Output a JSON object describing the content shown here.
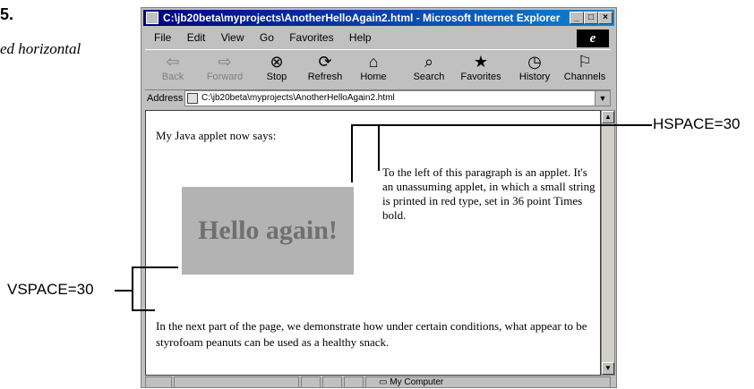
{
  "fragment": {
    "number": "5.",
    "caption": "ed horizontal"
  },
  "window": {
    "title": "C:\\jb20beta\\myprojects\\AnotherHelloAgain2.html - Microsoft Internet Explorer",
    "controls": [
      "minimize",
      "maximize",
      "close"
    ]
  },
  "menu": [
    {
      "label": "File",
      "accel": "F"
    },
    {
      "label": "Edit",
      "accel": "E"
    },
    {
      "label": "View",
      "accel": "V"
    },
    {
      "label": "Go",
      "accel": "G"
    },
    {
      "label": "Favorites",
      "accel": "a"
    },
    {
      "label": "Help",
      "accel": "H"
    }
  ],
  "toolbar": {
    "back": "Back",
    "forward": "Forward",
    "stop": "Stop",
    "refresh": "Refresh",
    "home": "Home",
    "search": "Search",
    "favorites": "Favorites",
    "history": "History",
    "channels": "Channels"
  },
  "address": {
    "label": "Address",
    "value": "C:\\jb20beta\\myprojects\\AnotherHelloAgain2.html"
  },
  "content": {
    "intro": "My Java applet now says:",
    "applet_text": "Hello again!",
    "side_paragraph": "To the left of this paragraph is an applet. It's an unassuming applet, in which a small string is printed in red type, set in 36 point Times bold.",
    "next_paragraph": "In the next part of the page, we demonstrate how under certain conditions, what appear to be styrofoam peanuts can be used as a healthy snack."
  },
  "status": {
    "zone": "My Computer"
  },
  "annotations": {
    "hspace": "HSPACE=30",
    "vspace": "VSPACE=30"
  },
  "colors": {
    "titlebar": "#000080",
    "applet_bg": "#b3b3b3",
    "applet_text": "#707070"
  }
}
